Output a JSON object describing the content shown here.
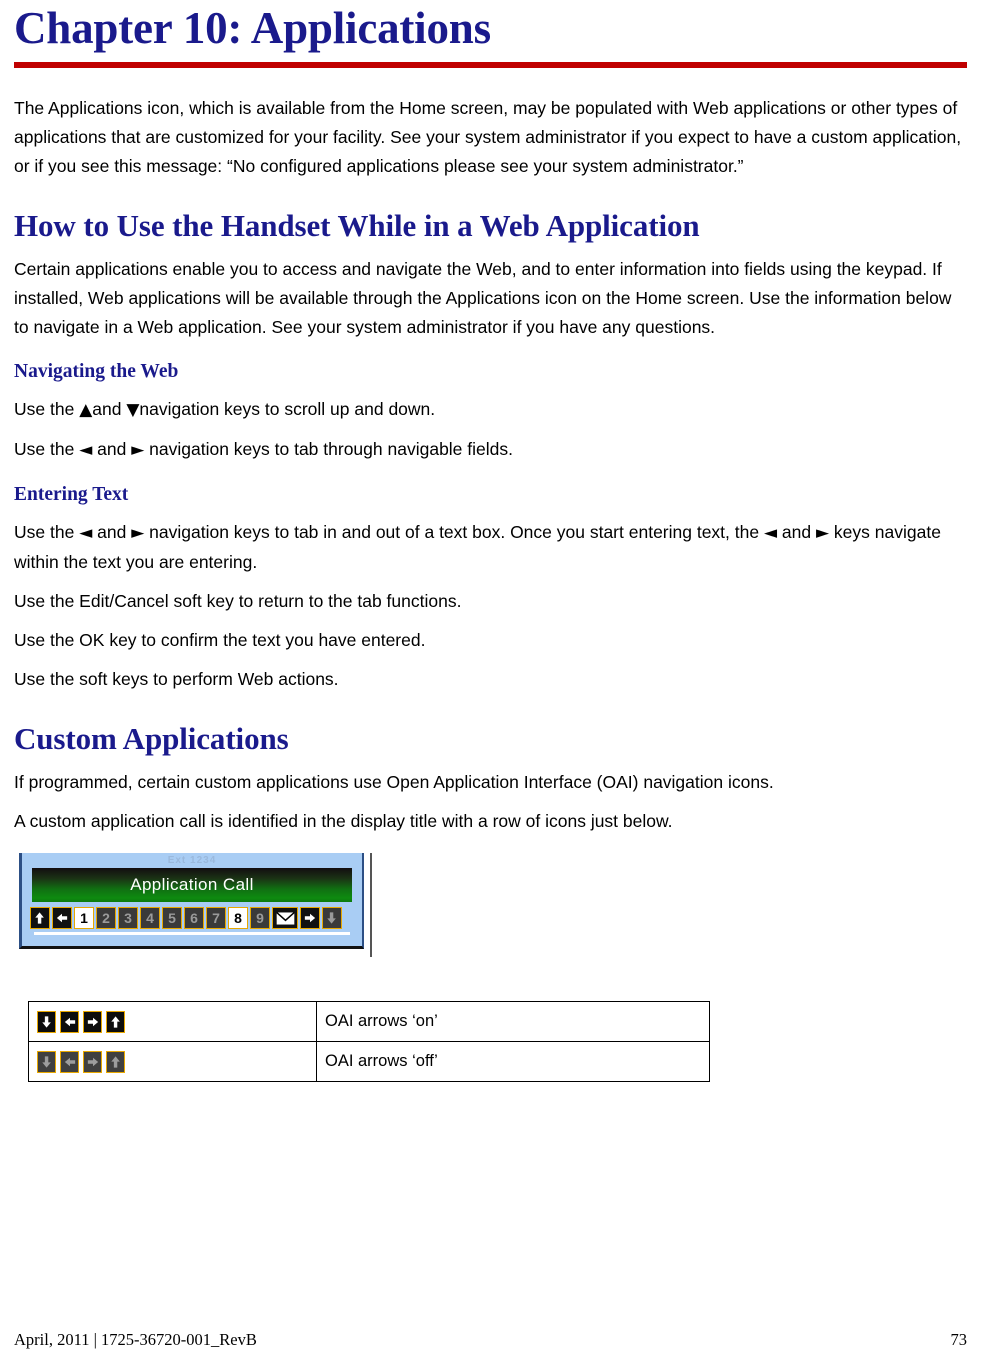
{
  "chapter": {
    "title": "Chapter 10: Applications",
    "intro": "The Applications icon, which is available from the Home screen, may be populated with Web applications or other types of applications that are customized for your facility. See your system administrator if you expect to have a custom application, or if you see this message: “No configured applications please see your system administrator.”"
  },
  "section_web": {
    "heading": "How to Use the Handset While in a Web Application",
    "intro": "Certain applications enable you to access and navigate the Web, and to enter information into fields using the keypad. If installed, Web applications will be available through the Applications icon on the Home screen. Use the information below to navigate in a Web application. See your system administrator if you have any questions.",
    "navigating": {
      "heading": "Navigating the Web",
      "line1_pre": "Use the ",
      "line1_up": "▲",
      "line1_mid": "and ",
      "line1_down": "▼",
      "line1_post": "navigation keys to scroll up and down.",
      "line2_pre": "Use the ",
      "line2_left": "◄",
      "line2_mid": " and ",
      "line2_right": "►",
      "line2_post": " navigation keys to tab through navigable fields."
    },
    "entering": {
      "heading": "Entering Text",
      "p1_pre": "Use the ",
      "p1_left": "◄",
      "p1_mid": " and ",
      "p1_right": "►",
      "p1_mid2": " navigation keys to tab in and out of a text box. Once you start entering text, the ",
      "p1_left2": "◄",
      "p1_mid3": " and ",
      "p1_right2": "►",
      "p1_post": " keys navigate within the text you are entering.",
      "p2": "Use the Edit/Cancel soft key to return to the tab functions.",
      "p3": "Use the OK key to confirm the text you have entered.",
      "p4": "Use the soft keys to perform Web actions."
    }
  },
  "section_custom": {
    "heading": "Custom Applications",
    "p1": "If programmed, certain custom applications use Open Application Interface (OAI) navigation icons.",
    "p2": "A custom application call is identified in the display title with a row of icons just below."
  },
  "phone_figure": {
    "top_text": "Ext 1234",
    "title_bar": "Application Call",
    "icons": [
      {
        "type": "arrow-up",
        "state": "dark",
        "label": ""
      },
      {
        "type": "arrow-left",
        "state": "dark",
        "label": ""
      },
      {
        "type": "digit",
        "state": "lit",
        "label": "1"
      },
      {
        "type": "digit",
        "state": "dim",
        "label": "2"
      },
      {
        "type": "digit",
        "state": "dim",
        "label": "3"
      },
      {
        "type": "digit",
        "state": "dim",
        "label": "4"
      },
      {
        "type": "digit",
        "state": "dim",
        "label": "5"
      },
      {
        "type": "digit",
        "state": "dim",
        "label": "6"
      },
      {
        "type": "digit",
        "state": "dim",
        "label": "7"
      },
      {
        "type": "digit",
        "state": "lit",
        "label": "8"
      },
      {
        "type": "digit",
        "state": "dim",
        "label": "9"
      },
      {
        "type": "envelope",
        "state": "dark",
        "label": ""
      },
      {
        "type": "arrow-right",
        "state": "dark",
        "label": ""
      },
      {
        "type": "arrow-down",
        "state": "dim",
        "label": ""
      }
    ]
  },
  "icon_table": {
    "rows": [
      {
        "label": "OAI arrows ‘on’",
        "state": "on",
        "icons": [
          "arrow-down",
          "arrow-left",
          "arrow-right",
          "arrow-up"
        ]
      },
      {
        "label": "OAI arrows ‘off’",
        "state": "off",
        "icons": [
          "arrow-down",
          "arrow-left",
          "arrow-right",
          "arrow-up"
        ]
      }
    ]
  },
  "footer": {
    "left": "April, 2011  |  1725-36720-001_RevB",
    "page": "73"
  },
  "colors": {
    "heading_blue": "#1a1a8c",
    "rule_red": "#c00000",
    "phone_bg": "#a9cdf4",
    "icon_border_gold": "#e8a800",
    "title_bar_green": "#0e8a10"
  }
}
